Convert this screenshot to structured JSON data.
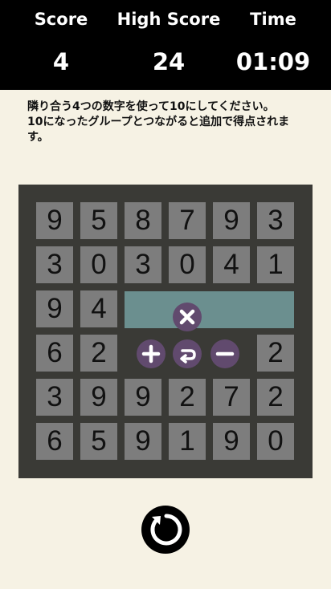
{
  "header": {
    "score_label": "Score",
    "score_value": "4",
    "high_score_label": "High Score",
    "high_score_value": "24",
    "time_label": "Time",
    "time_value": "01:09"
  },
  "instructions": {
    "line1": "隣り合う4つの数字を使って10にしてください。",
    "line2": "10になったグループとつながると追加で得点されます。"
  },
  "board": {
    "rows": [
      [
        "9",
        "5",
        "8",
        "7",
        "9",
        "3"
      ],
      [
        "3",
        "0",
        "3",
        "0",
        "4",
        "1"
      ],
      [
        "9",
        "4",
        "",
        "",
        "",
        ""
      ],
      [
        "6",
        "2",
        "",
        "",
        "",
        "2"
      ],
      [
        "3",
        "9",
        "9",
        "2",
        "7",
        "2"
      ],
      [
        "6",
        "5",
        "9",
        "1",
        "9",
        "0"
      ]
    ]
  },
  "operators": {
    "multiply_icon": "multiply-icon",
    "add_icon": "plus-icon",
    "undo_icon": "undo-icon",
    "subtract_icon": "minus-icon"
  },
  "controls": {
    "restart_icon": "restart-icon"
  },
  "colors": {
    "background": "#f6f2e4",
    "header": "#000000",
    "board": "#3a3a36",
    "cell": "#7d7d7d",
    "selection": "#6b8f8f",
    "operator_button": "#614a6e"
  }
}
